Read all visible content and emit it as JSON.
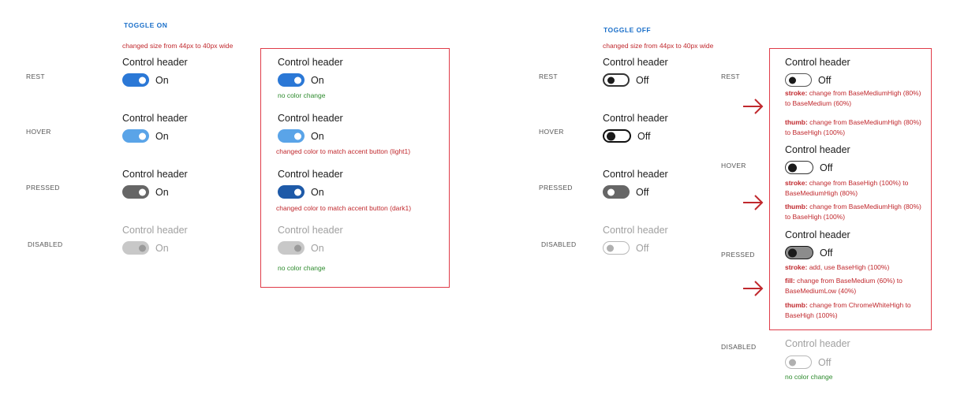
{
  "toggle_on": {
    "title": "TOGGLE ON",
    "size_note": "changed size from 44px to 40px wide",
    "states": {
      "rest": "REST",
      "hover": "HOVER",
      "pressed": "PRESSED",
      "disabled": "DISABLED"
    },
    "header": "Control header",
    "value_label": "On",
    "notes": {
      "rest": "no color change",
      "hover": "changed color to match accent button (light1)",
      "pressed": "changed color to match accent button (dark1)",
      "disabled": "no color change"
    }
  },
  "toggle_off": {
    "title": "TOGGLE OFF",
    "size_note": "changed size from 44px to 40px wide",
    "states": {
      "rest": "REST",
      "hover": "HOVER",
      "pressed": "PRESSED",
      "disabled": "DISABLED"
    },
    "header": "Control header",
    "value_label": "Off",
    "notes": {
      "rest_stroke_key": "stroke:",
      "rest_stroke": " change from BaseMediumHigh (80%) to BaseMedium (60%)",
      "rest_thumb_key": "thumb:",
      "rest_thumb": " change from BaseMediumHigh (80%) to BaseHigh (100%)",
      "hover_stroke_key": "stroke:",
      "hover_stroke": " change from BaseHigh (100%) to BaseMediumHigh (80%)",
      "hover_thumb_key": "thumb:",
      "hover_thumb": " change from BaseMediumHigh (80%) to BaseHigh (100%)",
      "pressed_stroke_key": "stroke:",
      "pressed_stroke": " add, use BaseHigh (100%)",
      "pressed_fill_key": "fill:",
      "pressed_fill": " change from BaseMedium (60%) to BaseMediumLow (40%)",
      "pressed_thumb_key": "thumb:",
      "pressed_thumb": " change from ChromeWhiteHigh to BaseHigh (100%)",
      "disabled": "no color change"
    }
  },
  "colors": {
    "accent": "#2b78d6",
    "accent_light1": "#5aa4e8",
    "accent_dark1": "#1e5aa8",
    "annotation_red": "#c0282d",
    "annotation_green": "#2e8b2e",
    "title_blue": "#1a6fc9",
    "box_red": "#e03b48"
  },
  "icons": {
    "arrow": "right-arrow-icon"
  }
}
